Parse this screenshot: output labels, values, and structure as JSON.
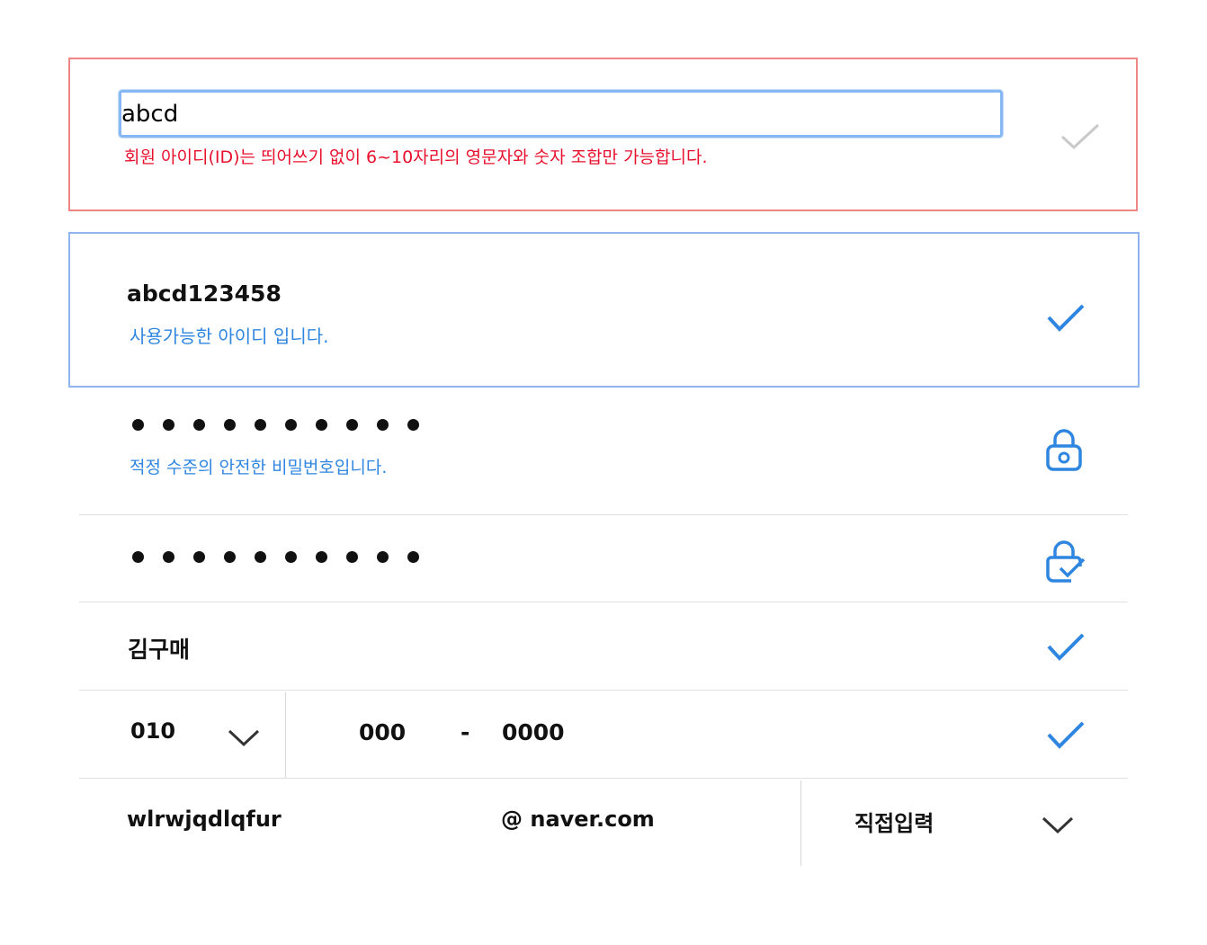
{
  "colors": {
    "error": "#e8112d",
    "error_border": "#f08585",
    "success": "#2f86e0",
    "success_border": "#8fb4f0",
    "divider": "#e1e1e1",
    "inactive_check": "#c9c9c9"
  },
  "id_field_error": {
    "value": "abcd",
    "message": "회원 아이디(ID)는 띄어쓰기 없이 6~10자리의 영문자와 숫자 조합만 가능합니다.",
    "status_icon": "check-icon"
  },
  "id_field_valid": {
    "value": "abcd123458",
    "message": "사용가능한 아이디 입니다.",
    "status_icon": "check-icon"
  },
  "password": {
    "masked_length": 10,
    "message": "적정 수준의 안전한 비밀번호입니다.",
    "status_icon": "lock-icon"
  },
  "password_confirm": {
    "masked_length": 10,
    "status_icon": "lock-check-icon"
  },
  "name": {
    "value": "김구매",
    "status_icon": "check-icon"
  },
  "phone": {
    "prefix": "010",
    "middle": "000",
    "separator": "-",
    "last": "0000",
    "status_icon": "check-icon"
  },
  "email": {
    "local": "wlrwjqdlqfur",
    "domain": "@ naver.com",
    "domain_select": "직접입력"
  }
}
